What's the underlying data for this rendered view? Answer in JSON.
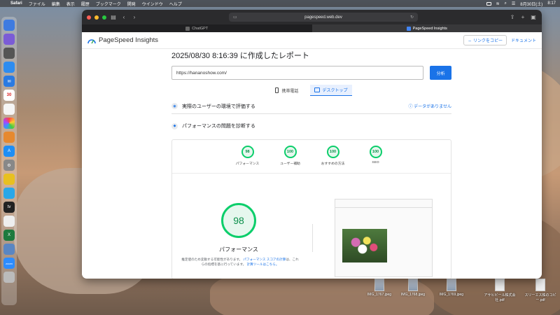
{
  "menubar": {
    "app": "Safari",
    "items": [
      "ファイル",
      "編集",
      "表示",
      "履歴",
      "ブックマーク",
      "開発",
      "ウインドウ",
      "ヘルプ"
    ],
    "date": "8月30日(土)",
    "time": "8:17"
  },
  "browser": {
    "url": "pagespeed.web.dev",
    "tabs": [
      "ChatGPT",
      "PageSpeed Insights"
    ]
  },
  "psi": {
    "brand": "PageSpeed Insights",
    "copy_link": "リンクをコピー",
    "docs": "ドキュメント",
    "report_title": "2025/08/30 8:16:39 に作成したレポート",
    "url_value": "https://hananoshow.com/",
    "analyze": "分析",
    "mobile_tab": "携帯電話",
    "desktop_tab": "デスクトップ",
    "field_section": "実際のユーザーの環境で評価する",
    "no_data": "データがありません",
    "diagnose_section": "パフォーマンスの問題を診断する",
    "gauges": [
      {
        "score": "98",
        "label": "パフォーマンス"
      },
      {
        "score": "100",
        "label": "ユーザー補助"
      },
      {
        "score": "100",
        "label": "おすすめの方法"
      },
      {
        "score": "100",
        "label": "SEO"
      }
    ],
    "main_score": "98",
    "main_label": "パフォーマンス",
    "note_1": "推定値のため変動する可能性があります。",
    "note_link_1": "パフォーマンス スコアの計算",
    "note_2": "は、これらの指標を基に行っています。",
    "note_link_2": "計算ツールはこちら。"
  },
  "desktop_files": [
    {
      "name": "IMG_1767.jpeg"
    },
    {
      "name": "IMG_1768.jpeg"
    },
    {
      "name": "IMG_1769.jpeg"
    },
    {
      "name": "アサヒビール株式会社.pdf"
    },
    {
      "name": "スリーエス株のコピー.pdf"
    }
  ],
  "dock": {
    "calendar_day": "30",
    "tv_label": "tv",
    "zoom_label": "zoom"
  },
  "colors": {
    "accent": "#1a73e8",
    "good": "#0cce6b"
  }
}
